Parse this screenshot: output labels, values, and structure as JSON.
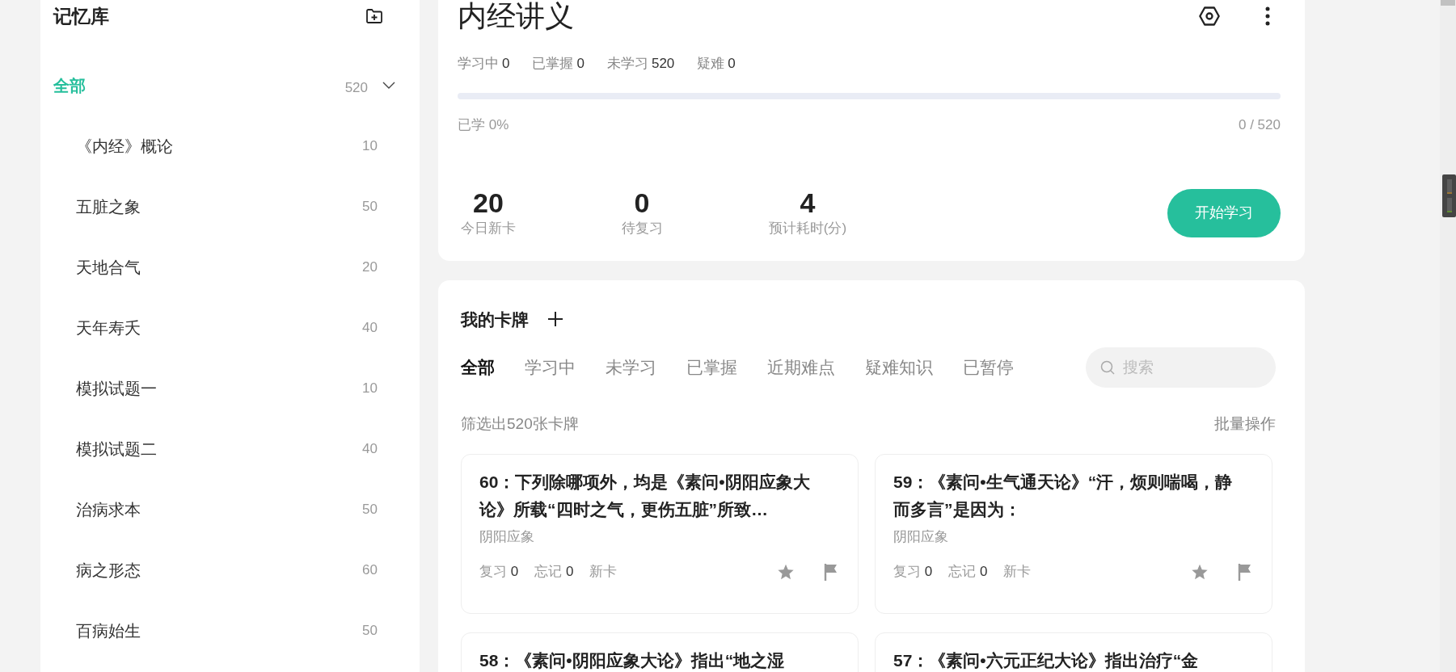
{
  "sidebar": {
    "title": "记忆库",
    "root": {
      "label": "全部",
      "count": "520",
      "selected": true,
      "expanded": true,
      "children": [
        {
          "label": "《内经》概论",
          "count": "10",
          "selected": false
        },
        {
          "label": "五脏之象",
          "count": "50",
          "selected": false
        },
        {
          "label": "天地合气",
          "count": "20",
          "selected": false
        },
        {
          "label": "天年寿夭",
          "count": "40",
          "selected": false
        },
        {
          "label": "模拟试题一",
          "count": "10",
          "selected": false
        },
        {
          "label": "模拟试题二",
          "count": "40",
          "selected": false
        },
        {
          "label": "治病求本",
          "count": "50",
          "selected": false
        },
        {
          "label": "病之形态",
          "count": "60",
          "selected": false
        },
        {
          "label": "百病始生",
          "count": "50",
          "selected": false
        }
      ]
    }
  },
  "deck": {
    "title": "内经讲义",
    "stats": [
      {
        "label": "学习中",
        "value": "0"
      },
      {
        "label": "已掌握",
        "value": "0"
      },
      {
        "label": "未学习",
        "value": "520"
      },
      {
        "label": "疑难",
        "value": "0"
      }
    ],
    "progress": {
      "level": 0,
      "label": "已学 0%",
      "reading": "0 / 520"
    },
    "summary": [
      {
        "value": "20",
        "label": "今日新卡"
      },
      {
        "value": "0",
        "label": "待复习"
      },
      {
        "value": "4",
        "label": "预计耗时(分)"
      }
    ],
    "start_button": "开始学习"
  },
  "cards_panel": {
    "title": "我的卡牌",
    "tabs": [
      {
        "label": "全部",
        "selected": true
      },
      {
        "label": "学习中",
        "selected": false
      },
      {
        "label": "未学习",
        "selected": false
      },
      {
        "label": "已掌握",
        "selected": false
      },
      {
        "label": "近期难点",
        "selected": false
      },
      {
        "label": "疑难知识",
        "selected": false
      },
      {
        "label": "已暂停",
        "selected": false
      }
    ],
    "search": {
      "placeholder": "搜索"
    },
    "filter_text": "筛选出520张卡牌",
    "batch_action": "批量操作",
    "cards": [
      {
        "title": "60：下列除哪项外，均是《素问•阴阳应象大论》所载“四时之气，更伤五脏”所致…",
        "tag": "阴阳应象",
        "review_label": "复习",
        "review": "0",
        "forget_label": "忘记",
        "forget": "0",
        "status": "新卡",
        "starred": false,
        "flagged": false
      },
      {
        "title": "59：《素问•生气通天论》“汗，烦则喘喝，静而多言”是因为：",
        "tag": "阴阳应象",
        "review_label": "复习",
        "review": "0",
        "forget_label": "忘记",
        "forget": "0",
        "status": "新卡",
        "starred": false,
        "flagged": false
      },
      {
        "title": "58：《素问•阴阳应象大论》指出“地之湿"
      },
      {
        "title": "57：《素问•六元正纪大论》指出治疗“金"
      }
    ]
  }
}
